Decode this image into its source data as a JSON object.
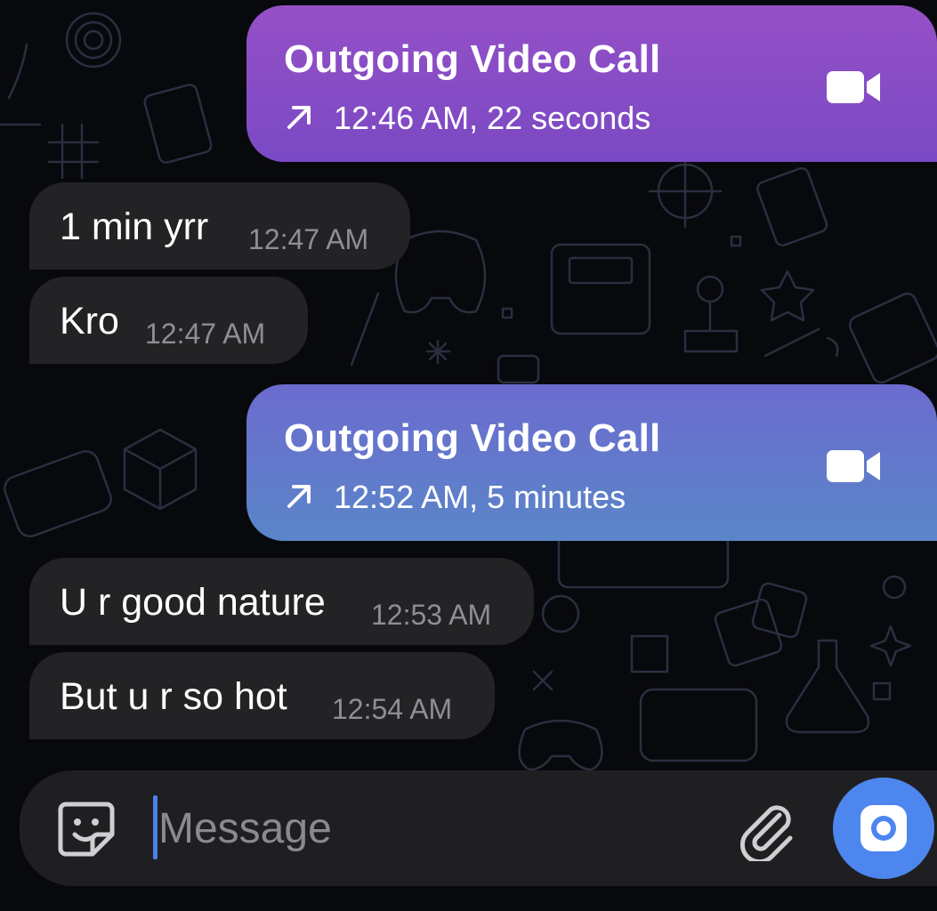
{
  "theme": {
    "background": "#08090c",
    "call_bubble_1_gradient": [
      "#9550c6",
      "#7a49c4"
    ],
    "call_bubble_2_gradient": [
      "#6c6bcf",
      "#5a86c8"
    ],
    "incoming_bubble": "#232325",
    "timestamp_color": "#8e8e93",
    "send_button": "#4e86f0"
  },
  "messages": [
    {
      "type": "call",
      "direction": "outgoing",
      "title": "Outgoing Video Call",
      "meta": "12:46 AM, 22 seconds",
      "arrow_icon": "arrow-up-right-icon",
      "call_icon": "video-camera-icon"
    },
    {
      "type": "text",
      "direction": "incoming",
      "text": "1 min yrr",
      "time": "12:47 AM"
    },
    {
      "type": "text",
      "direction": "incoming",
      "text": "Kro",
      "time": "12:47 AM"
    },
    {
      "type": "call",
      "direction": "outgoing",
      "title": "Outgoing Video Call",
      "meta": "12:52 AM, 5 minutes",
      "arrow_icon": "arrow-up-right-icon",
      "call_icon": "video-camera-icon"
    },
    {
      "type": "text",
      "direction": "incoming",
      "text": "U r good nature",
      "time": "12:53 AM"
    },
    {
      "type": "text",
      "direction": "incoming",
      "text": "But u r so hot",
      "time": "12:54 AM"
    }
  ],
  "composer": {
    "placeholder": "Message",
    "value": "",
    "left_icon": "sticker-icon",
    "attach_icon": "paperclip-icon",
    "action_icon": "camera-icon"
  }
}
